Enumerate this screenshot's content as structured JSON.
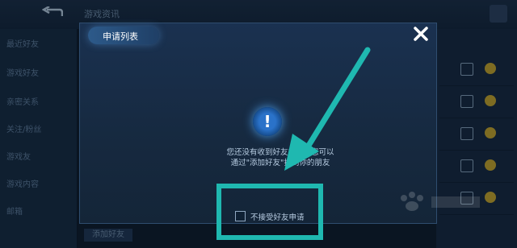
{
  "background": {
    "top_title": "游戏资讯",
    "left_items": [
      "最近好友",
      "游戏好友",
      "亲密关系",
      "关注/粉丝",
      "游戏友",
      "游戏内容",
      "邮箱"
    ],
    "bottom_button": "添加好友"
  },
  "dialog": {
    "title": "申请列表",
    "message_line1": "您还没有收到好友申请，您可以",
    "message_line2": "通过\"添加好友\"找到你的朋友",
    "checkbox_label": "不接受好友申请",
    "checkbox_checked": false
  },
  "colors": {
    "highlight": "#1fb8b0",
    "accent": "#2a72c9"
  },
  "icons": {
    "close": "close-icon",
    "info": "exclamation-info-icon",
    "back": "back-arrow-icon"
  }
}
